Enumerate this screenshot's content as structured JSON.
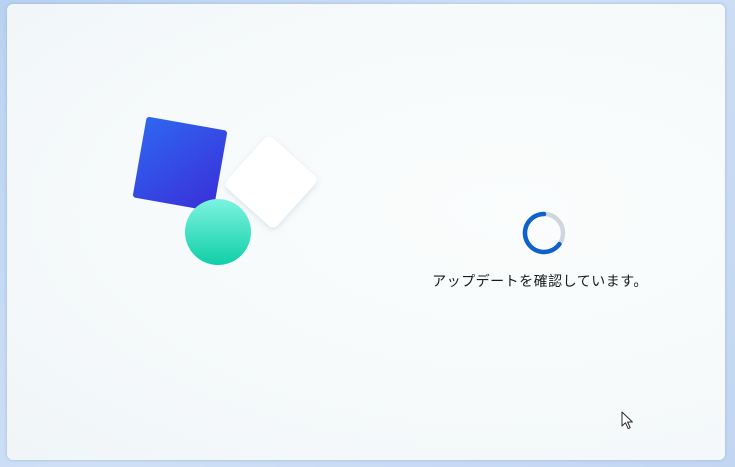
{
  "setup_screen": {
    "status_message": "アップデートを確認しています。",
    "progress_state": "indeterminate"
  },
  "illustration": {
    "shapes": [
      "blue-square",
      "white-square",
      "teal-circle"
    ],
    "colors": {
      "blue_square_start": "#2f66f0",
      "blue_square_end": "#3a2fd8",
      "white_square": "#ffffff",
      "teal_circle_start": "#7df3e1",
      "teal_circle_end": "#10cfa8"
    }
  },
  "spinner": {
    "icon": "loading-spinner-icon",
    "accent_color": "#0f62c9",
    "track_color": "#d0d6de"
  },
  "cursor": {
    "icon": "mouse-pointer-icon"
  }
}
